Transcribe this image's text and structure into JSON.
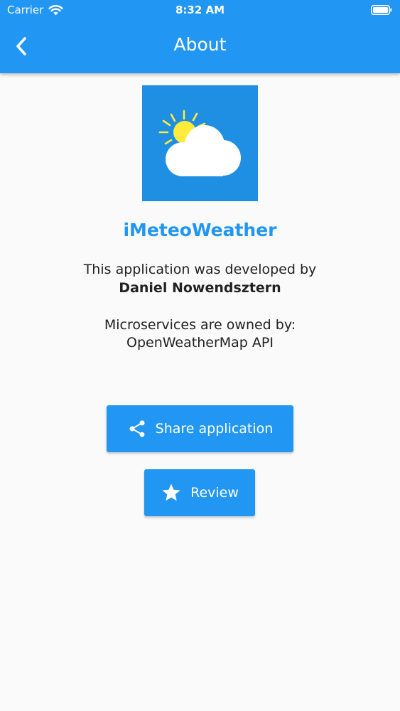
{
  "status_bar": {
    "carrier": "Carrier",
    "time": "8:32 AM"
  },
  "app_bar": {
    "title": "About",
    "back_icon": "chevron-left-icon"
  },
  "content": {
    "logo_icon": "sun-cloud-icon",
    "app_name": "iMeteoWeather",
    "developed_by_label": "This application was developed by",
    "developer_name": "Daniel Nowendsztern",
    "microservices_label": "Microservices are owned by:",
    "microservices_owner": "OpenWeatherMap API"
  },
  "buttons": {
    "share": {
      "label": "Share application",
      "icon": "share-icon"
    },
    "review": {
      "label": "Review",
      "icon": "star-icon"
    }
  },
  "colors": {
    "primary": "#2196f3",
    "logo_background": "#1e8fe3",
    "sun": "#ffeb3b",
    "background": "#fafafa"
  }
}
